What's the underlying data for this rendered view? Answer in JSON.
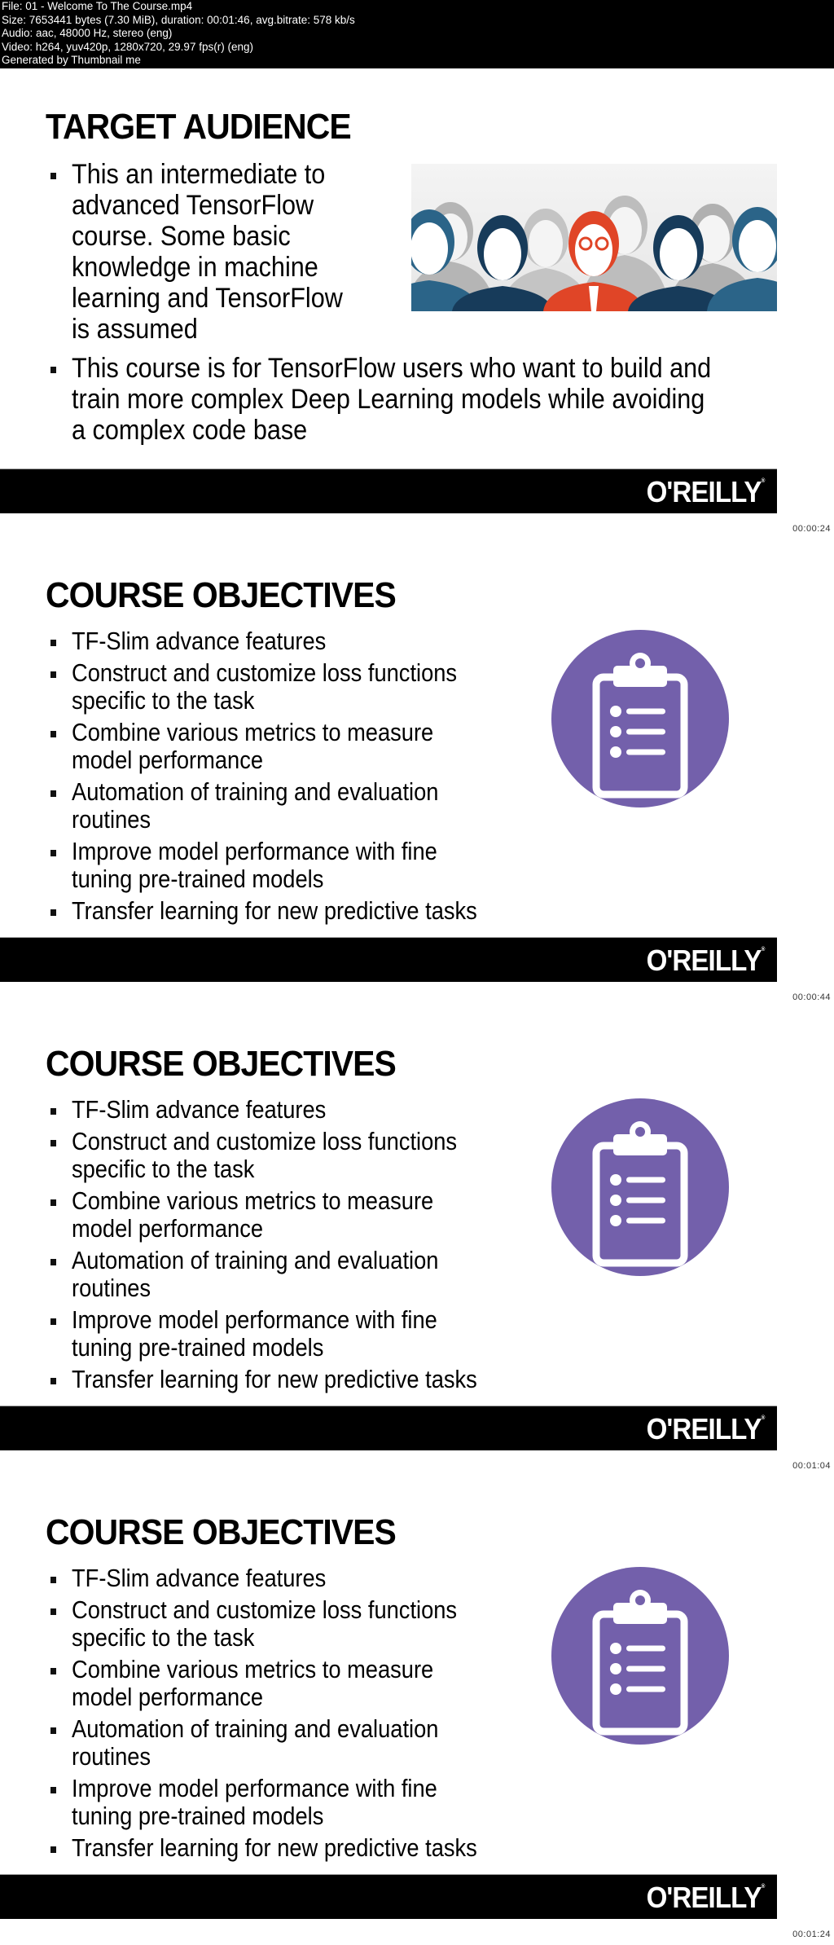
{
  "header": {
    "lines": [
      "File: 01 - Welcome To The Course.mp4",
      "Size: 7653441 bytes (7.30 MiB), duration: 00:01:46, avg.bitrate: 578 kb/s",
      "Audio: aac, 48000 Hz, stereo (eng)",
      "Video: h264, yuv420p, 1280x720, 29.97 fps(r) (eng)",
      "Generated by Thumbnail me"
    ]
  },
  "colors": {
    "accent_purple": "#7360ab",
    "bar": "#000000",
    "figure_red": "#e04527",
    "figure_blue": "#2b6488",
    "figure_navy": "#173b5a",
    "figure_gray": "#a8a8a8"
  },
  "brand": "O'REILLY",
  "frames": [
    {
      "timestamp": "00:00:24",
      "title": "TARGET AUDIENCE",
      "bullets": [
        [
          "This an intermediate to",
          "advanced TensorFlow",
          "course. Some basic",
          "knowledge in machine",
          "learning and TensorFlow",
          "is assumed"
        ],
        [
          "This course is for TensorFlow users who want to build and",
          "train more complex Deep Learning models while avoiding",
          "a complex code base"
        ]
      ],
      "image": "people-group-illustration"
    },
    {
      "timestamp": "00:00:44",
      "title": "COURSE OBJECTIVES",
      "icon": "clipboard-list-icon",
      "bullets": [
        [
          "TF-Slim advance features"
        ],
        [
          "Construct and customize loss functions",
          "specific to the task"
        ],
        [
          "Combine various metrics to measure",
          "model performance"
        ],
        [
          "Automation of training and evaluation",
          "routines"
        ],
        [
          "Improve model performance with fine",
          "tuning pre-trained models"
        ],
        [
          "Transfer learning for new predictive tasks"
        ]
      ]
    },
    {
      "timestamp": "00:01:04",
      "title": "COURSE OBJECTIVES",
      "icon": "clipboard-list-icon",
      "bullets": [
        [
          "TF-Slim advance features"
        ],
        [
          "Construct and customize loss functions",
          "specific to the task"
        ],
        [
          "Combine various metrics to measure",
          "model performance"
        ],
        [
          "Automation of training and evaluation",
          "routines"
        ],
        [
          "Improve model performance with fine",
          "tuning pre-trained models"
        ],
        [
          "Transfer learning for new predictive tasks"
        ]
      ]
    },
    {
      "timestamp": "00:01:24",
      "title": "COURSE OBJECTIVES",
      "icon": "clipboard-list-icon",
      "bullets": [
        [
          "TF-Slim advance features"
        ],
        [
          "Construct and customize loss functions",
          "specific to the task"
        ],
        [
          "Combine various metrics to measure",
          "model performance"
        ],
        [
          "Automation of training and evaluation",
          "routines"
        ],
        [
          "Improve model performance with fine",
          "tuning pre-trained models"
        ],
        [
          "Transfer learning for new predictive tasks"
        ]
      ]
    }
  ]
}
